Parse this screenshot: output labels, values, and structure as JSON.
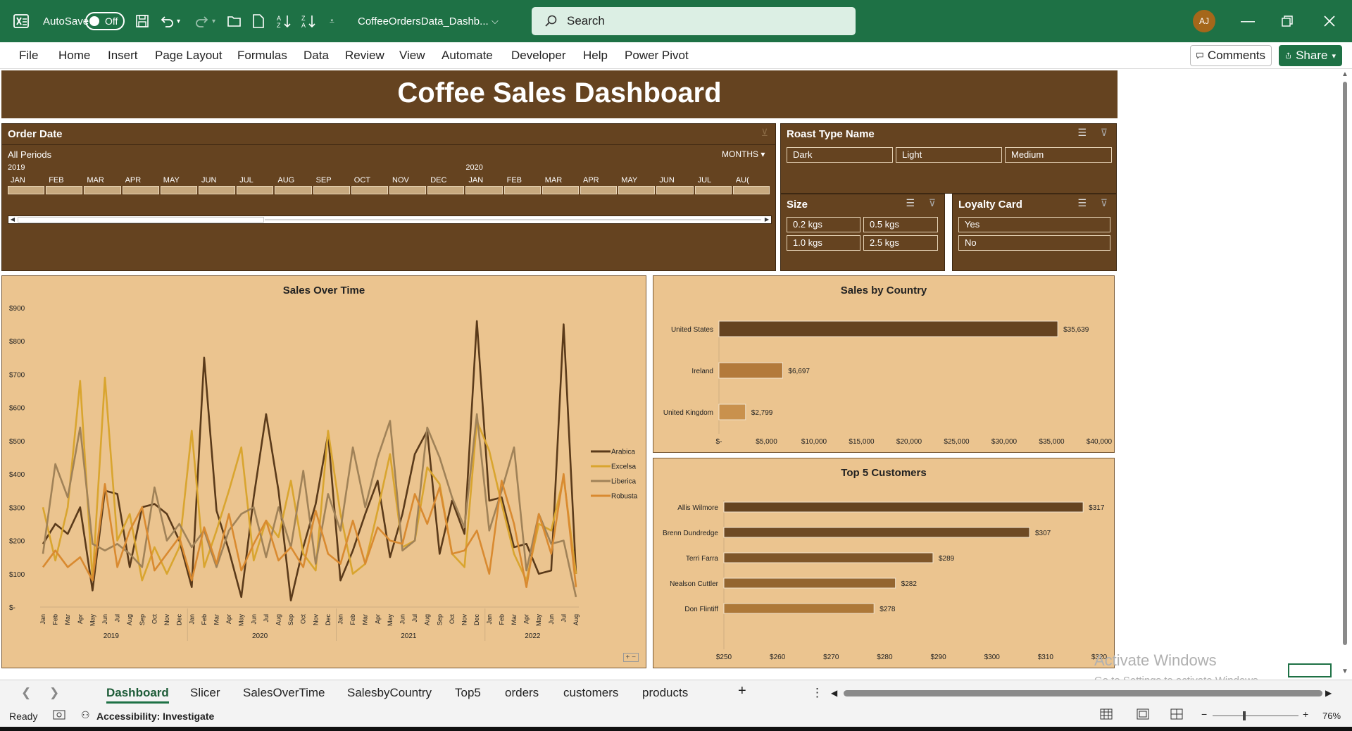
{
  "window": {
    "autosave_label": "AutoSave",
    "autosave_state": "Off",
    "filename": "CoffeeOrdersData_Dashb...",
    "search_placeholder": "Search",
    "avatar_initials": "AJ",
    "icons": [
      "excel-logo-icon",
      "save-icon",
      "undo-icon",
      "redo-icon",
      "open-icon",
      "new-icon",
      "sort-asc-icon",
      "sort-desc-icon",
      "customize-icon",
      "search-icon",
      "minimize-icon",
      "restore-icon",
      "close-icon"
    ]
  },
  "ribbon": {
    "tabs": [
      "File",
      "Home",
      "Insert",
      "Page Layout",
      "Formulas",
      "Data",
      "Review",
      "View",
      "Automate",
      "Developer",
      "Help",
      "Power Pivot"
    ],
    "comments_label": "Comments",
    "share_label": "Share"
  },
  "dashboard": {
    "title": "Coffee Sales Dashboard",
    "colors": {
      "banner": "#654320",
      "chart_bg": "#ebc48f",
      "arabica": "#5a3a1a",
      "excelsa": "#d9a52f",
      "liberica": "#a08258",
      "robusta": "#d98a30"
    }
  },
  "timeline": {
    "header": "Order Date",
    "period_label": "All Periods",
    "level_label": "MONTHS",
    "years": [
      "2019",
      "2020"
    ],
    "months": [
      "JAN",
      "FEB",
      "MAR",
      "APR",
      "MAY",
      "JUN",
      "JUL",
      "AUG",
      "SEP",
      "OCT",
      "NOV",
      "DEC",
      "JAN",
      "FEB",
      "MAR",
      "APR",
      "MAY",
      "JUN",
      "JUL",
      "AU("
    ],
    "scroll_position": 0.0
  },
  "slicers": {
    "roast": {
      "header": "Roast Type Name",
      "items": [
        "Dark",
        "Light",
        "Medium"
      ]
    },
    "size": {
      "header": "Size",
      "items": [
        "0.2 kgs",
        "0.5 kgs",
        "1.0 kgs",
        "2.5 kgs"
      ]
    },
    "loyalty": {
      "header": "Loyalty Card",
      "items": [
        "Yes",
        "No"
      ]
    }
  },
  "charts": {
    "sales_over_time": {
      "title": "Sales Over Time",
      "year_labels": [
        "2019",
        "2020",
        "2021",
        "2022"
      ]
    },
    "sales_by_country": {
      "title": "Sales by Country"
    },
    "top5": {
      "title": "Top 5 Customers"
    }
  },
  "chart_data": [
    {
      "type": "line",
      "title": "Sales Over Time",
      "y_ticks": [
        "$-",
        "$100",
        "$200",
        "$300",
        "$400",
        "$500",
        "$600",
        "$700",
        "$800",
        "$900"
      ],
      "ylim": [
        0,
        900
      ],
      "x": [
        "Jan",
        "Feb",
        "Mar",
        "Apr",
        "May",
        "Jun",
        "Jul",
        "Aug",
        "Sep",
        "Oct",
        "Nov",
        "Dec",
        "Jan",
        "Feb",
        "Mar",
        "Apr",
        "May",
        "Jun",
        "Jul",
        "Aug",
        "Sep",
        "Oct",
        "Nov",
        "Dec",
        "Jan",
        "Feb",
        "Mar",
        "Apr",
        "May",
        "Jun",
        "Jul",
        "Aug",
        "Sep",
        "Oct",
        "Nov",
        "Dec",
        "Jan",
        "Feb",
        "Mar",
        "Apr",
        "May",
        "Jun",
        "Jul",
        "Aug"
      ],
      "legend_position": "right",
      "series": [
        {
          "name": "Arabica",
          "values": [
            190,
            250,
            220,
            300,
            50,
            350,
            340,
            120,
            300,
            310,
            280,
            200,
            60,
            750,
            290,
            170,
            30,
            330,
            580,
            350,
            20,
            180,
            310,
            520,
            80,
            170,
            280,
            380,
            150,
            280,
            460,
            530,
            160,
            320,
            220,
            860,
            320,
            330,
            180,
            190,
            100,
            110,
            850,
            100
          ]
        },
        {
          "name": "Excelsa",
          "values": [
            300,
            140,
            300,
            680,
            80,
            690,
            200,
            280,
            80,
            180,
            100,
            180,
            530,
            120,
            230,
            350,
            480,
            140,
            260,
            210,
            380,
            160,
            110,
            530,
            280,
            100,
            130,
            290,
            460,
            180,
            200,
            420,
            370,
            160,
            120,
            560,
            470,
            310,
            160,
            80,
            250,
            230,
            390,
            100
          ]
        },
        {
          "name": "Liberica",
          "values": [
            160,
            430,
            330,
            540,
            190,
            170,
            190,
            160,
            120,
            360,
            200,
            250,
            180,
            230,
            120,
            230,
            280,
            300,
            150,
            300,
            180,
            410,
            130,
            340,
            230,
            480,
            300,
            450,
            560,
            170,
            200,
            540,
            450,
            330,
            240,
            580,
            230,
            350,
            480,
            110,
            280,
            190,
            200,
            30
          ]
        },
        {
          "name": "Robusta",
          "values": [
            120,
            170,
            120,
            150,
            80,
            370,
            120,
            230,
            300,
            110,
            160,
            210,
            80,
            240,
            130,
            280,
            110,
            190,
            260,
            140,
            180,
            120,
            290,
            160,
            130,
            260,
            130,
            240,
            200,
            190,
            340,
            250,
            360,
            160,
            170,
            230,
            100,
            380,
            250,
            60,
            280,
            160,
            400,
            60
          ]
        }
      ]
    },
    {
      "type": "bar",
      "orientation": "horizontal",
      "title": "Sales by Country",
      "categories": [
        "United States",
        "Ireland",
        "United Kingdom"
      ],
      "values": [
        35639,
        6697,
        2799
      ],
      "value_labels": [
        "$35,639",
        "$6,697",
        "$2,799"
      ],
      "x_ticks": [
        "$-",
        "$5,000",
        "$10,000",
        "$15,000",
        "$20,000",
        "$25,000",
        "$30,000",
        "$35,000",
        "$40,000"
      ],
      "xlim": [
        0,
        40000
      ]
    },
    {
      "type": "bar",
      "orientation": "horizontal",
      "title": "Top 5 Customers",
      "categories": [
        "Allis Wilmore",
        "Brenn Dundredge",
        "Terri Farra",
        "Nealson Cuttler",
        "Don Flintiff"
      ],
      "values": [
        317,
        307,
        289,
        282,
        278
      ],
      "value_labels": [
        "$317",
        "$307",
        "$289",
        "$282",
        "$278"
      ],
      "x_ticks": [
        "$250",
        "$260",
        "$270",
        "$280",
        "$290",
        "$300",
        "$310",
        "$320"
      ],
      "xlim": [
        250,
        320
      ]
    }
  ],
  "sheet_tabs": {
    "tabs": [
      "Dashboard",
      "Slicer",
      "SalesOverTime",
      "SalesbyCountry",
      "Top5",
      "orders",
      "customers",
      "products"
    ],
    "active": "Dashboard"
  },
  "status": {
    "ready": "Ready",
    "accessibility": "Accessibility: Investigate",
    "zoom": "76%"
  },
  "watermark": {
    "line1": "Activate Windows",
    "line2": "Go to Settings to activate Windows."
  }
}
